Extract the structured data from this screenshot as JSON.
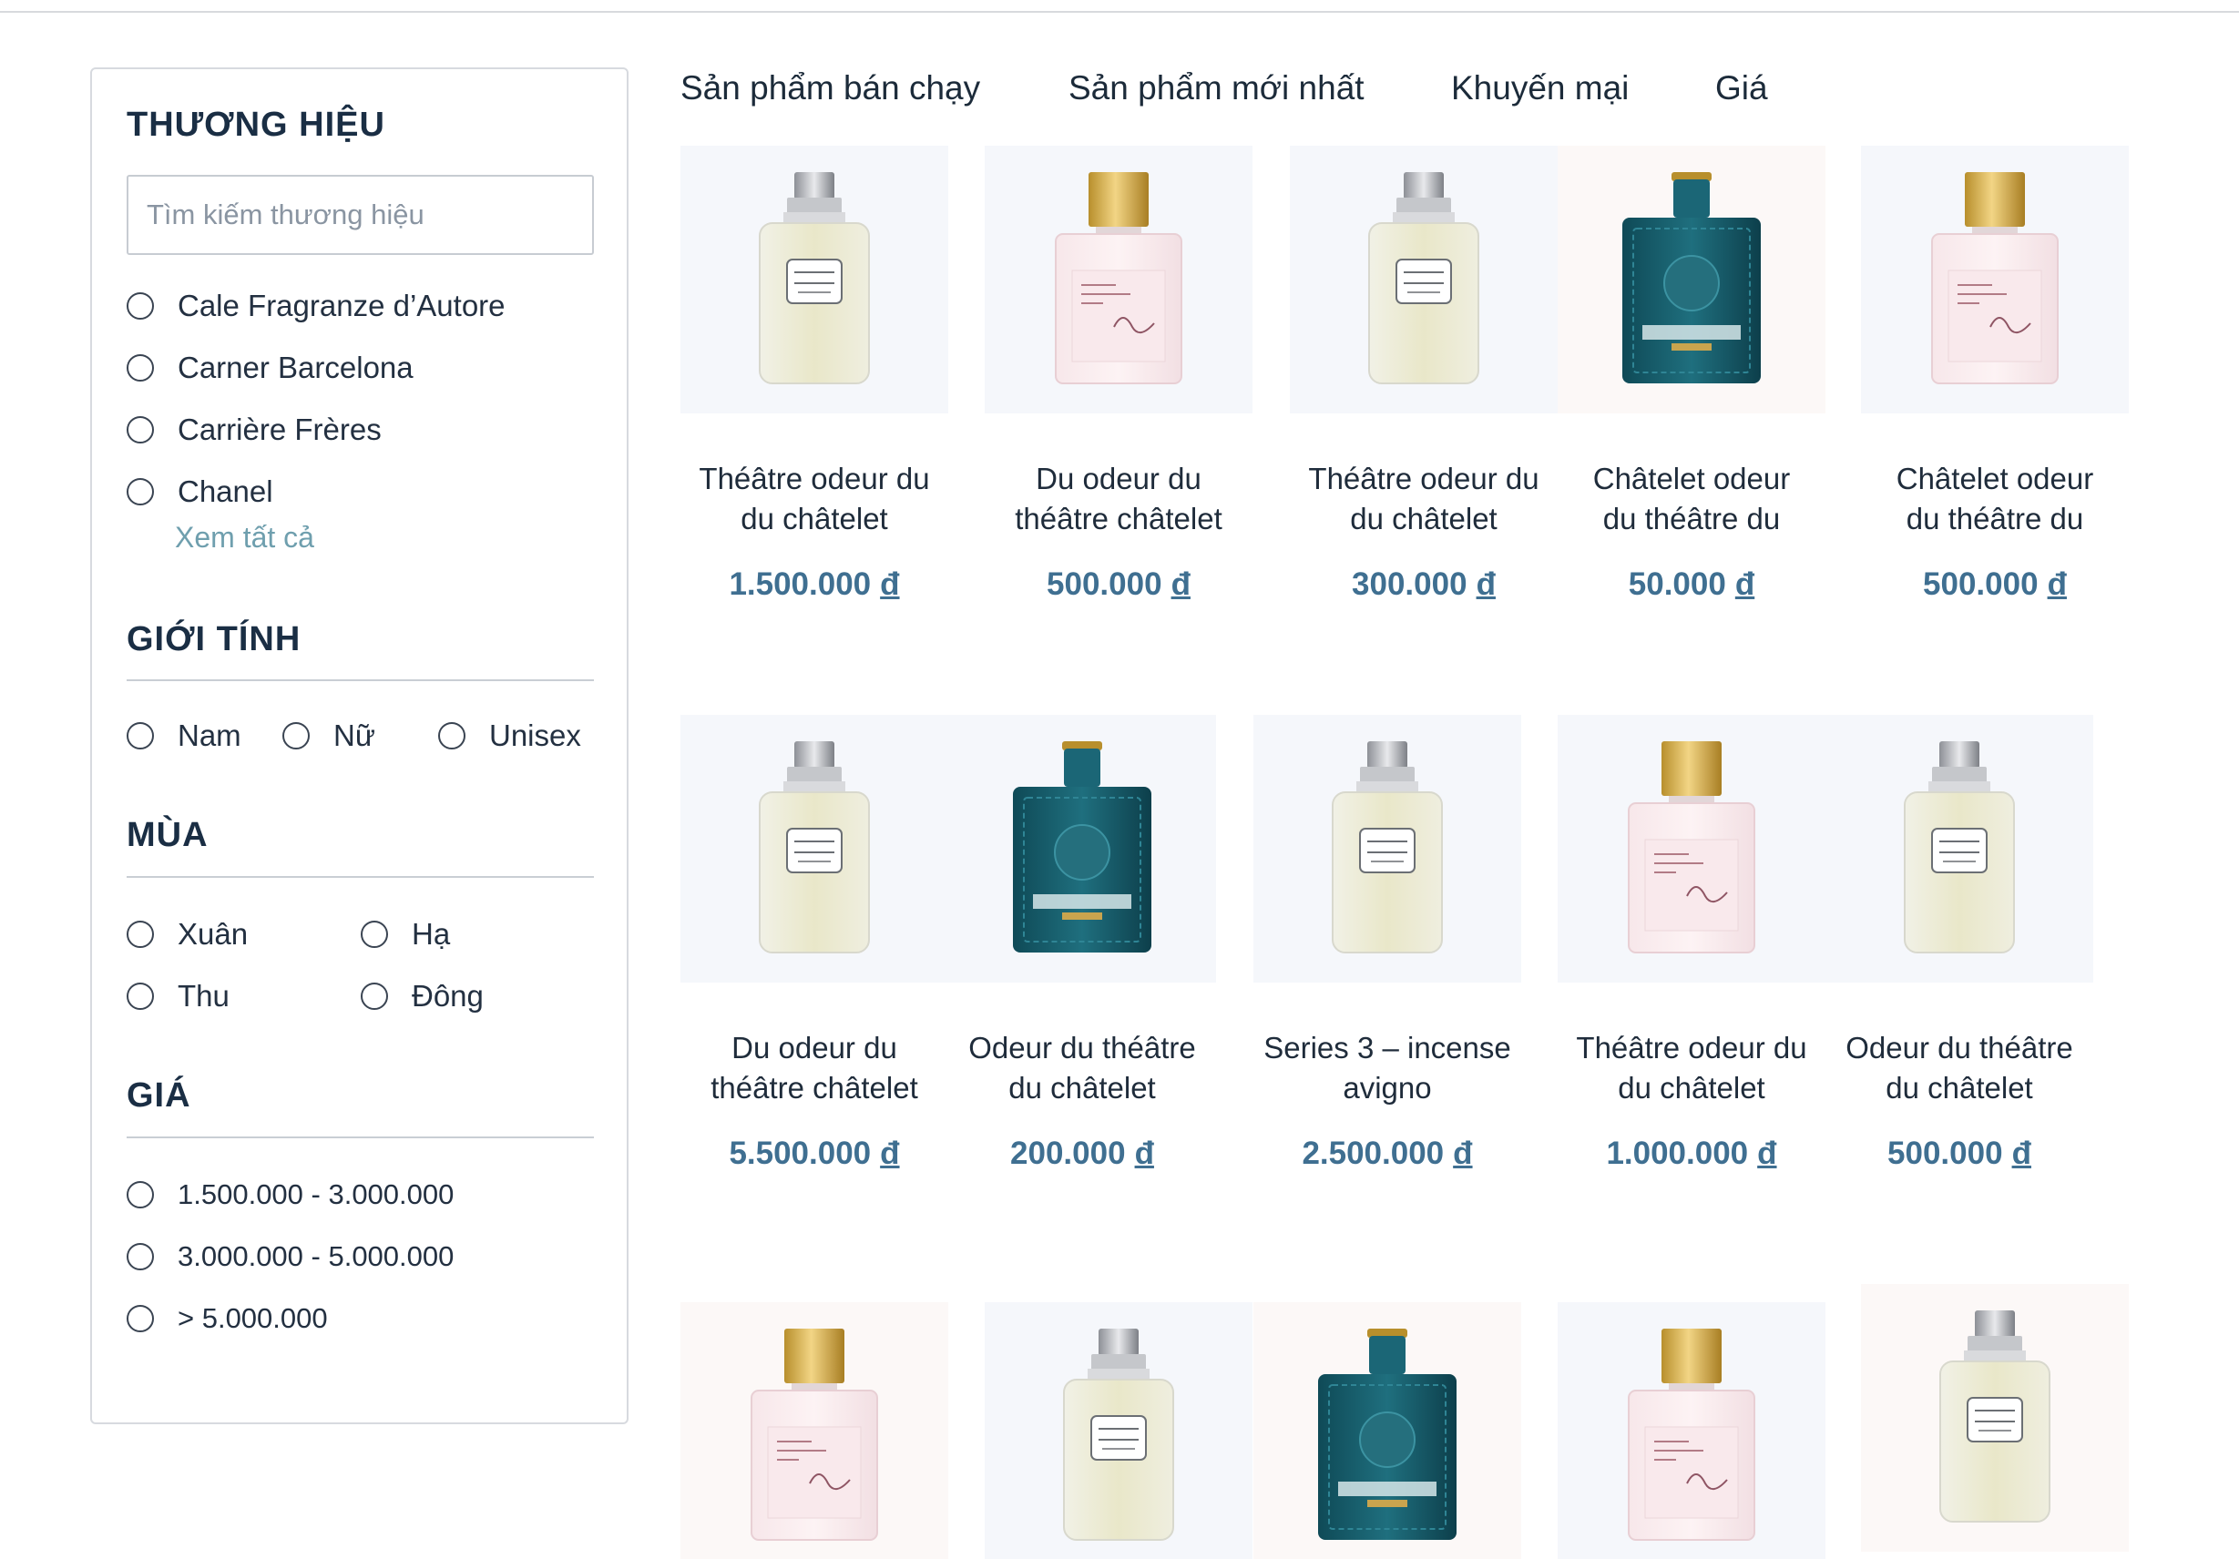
{
  "filters": {
    "brand": {
      "heading": "THƯƠNG HIỆU",
      "search_placeholder": "Tìm kiếm thương hiệu",
      "options": [
        "Cale Fragranze d’Autore",
        "Carner Barcelona",
        "Carrière Frères",
        "Chanel"
      ],
      "see_all": "Xem tất cả"
    },
    "gender": {
      "heading": "GIỚI TÍNH",
      "options": [
        "Nam",
        "Nữ",
        "Unisex"
      ]
    },
    "season": {
      "heading": "MÙA",
      "options": [
        "Xuân",
        "Hạ",
        "Thu",
        "Đông"
      ]
    },
    "price": {
      "heading": "GIÁ",
      "options": [
        "1.500.000 - 3.000.000",
        "3.000.000 - 5.000.000",
        "> 5.000.000"
      ]
    }
  },
  "sort_tabs": [
    "Sản phẩm bán chạy",
    "Sản phẩm mới nhất",
    "Khuyến mại",
    "Giá"
  ],
  "currency_symbol": "đ",
  "colors": {
    "heading": "#1a2e44",
    "price": "#3f6f91",
    "link": "#6f9fae"
  },
  "products": [
    {
      "name_line1": "Théâtre odeur du",
      "name_line2": "du châtelet",
      "price": "1.500.000",
      "image": "clear-bottle-icon"
    },
    {
      "name_line1": "Du odeur du",
      "name_line2": "théâtre châtelet",
      "price": "500.000",
      "image": "pink-bottle-icon"
    },
    {
      "name_line1": "Théâtre odeur du",
      "name_line2": "du châtelet",
      "price": "300.000",
      "image": "clear-bottle-icon"
    },
    {
      "name_line1": "Châtelet odeur",
      "name_line2": "du théâtre du",
      "price": "50.000",
      "image": "blue-bottle-icon"
    },
    {
      "name_line1": "Châtelet odeur",
      "name_line2": "du théâtre du",
      "price": "500.000",
      "image": "pink-bottle-icon"
    },
    {
      "name_line1": "Du odeur du",
      "name_line2": "théâtre châtelet",
      "price": "5.500.000",
      "image": "clear-bottle-icon"
    },
    {
      "name_line1": "Odeur du théâtre",
      "name_line2": "du châtelet",
      "price": "200.000",
      "image": "blue-bottle-icon"
    },
    {
      "name_line1": "Series 3 – incense",
      "name_line2": "avigno",
      "price": "2.500.000",
      "image": "clear-bottle-icon"
    },
    {
      "name_line1": "Théâtre odeur du",
      "name_line2": "du châtelet",
      "price": "1.000.000",
      "image": "pink-bottle-icon"
    },
    {
      "name_line1": "Odeur du théâtre",
      "name_line2": "du châtelet",
      "price": "500.000",
      "image": "clear-bottle-icon"
    },
    {
      "image": "pink-bottle-icon"
    },
    {
      "image": "clear-bottle-icon"
    },
    {
      "image": "blue-bottle-icon"
    },
    {
      "image": "pink-bottle-icon"
    },
    {
      "image": "clear-bottle-icon"
    }
  ]
}
